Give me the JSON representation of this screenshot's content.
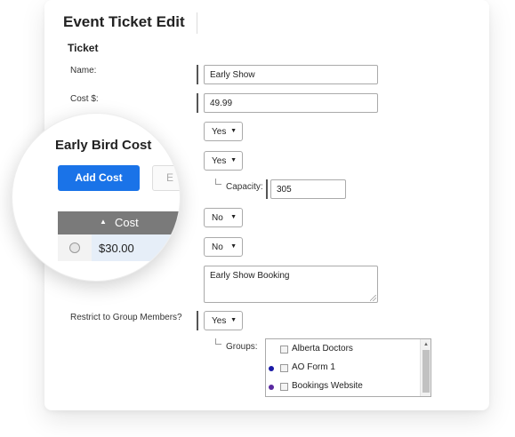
{
  "page": {
    "title": "Event Ticket Edit",
    "section": "Ticket"
  },
  "fields": {
    "name_label": "Name:",
    "name_value": "Early Show",
    "cost_label": "Cost $:",
    "cost_value": "49.99",
    "select1_value": "Yes",
    "select2_value": "Yes",
    "capacity_label": "Capacity:",
    "capacity_value": "305",
    "select3_value": "No",
    "select4_value": "No",
    "description_value": "Early Show Booking",
    "restrict_label": "Restrict to Group Members?",
    "restrict_value": "Yes",
    "groups_label": "Groups:"
  },
  "groups": [
    {
      "name": "Alberta Doctors",
      "dot": ""
    },
    {
      "name": "AO Form 1",
      "dot": "#1a1aa6"
    },
    {
      "name": "Bookings Website",
      "dot": "#5a2aa0"
    }
  ],
  "magnifier": {
    "title": "Early Bird Cost",
    "add_button": "Add Cost",
    "edit_button": "E",
    "column_header": "Cost",
    "row_value": "$30.00"
  },
  "colors": {
    "primary_button": "#1a73e8",
    "table_header": "#7a7a7a"
  }
}
